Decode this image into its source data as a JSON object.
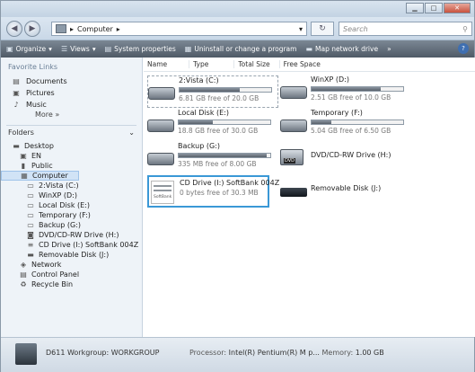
{
  "address": {
    "segments": [
      "Computer"
    ],
    "search_placeholder": "Search"
  },
  "toolbar": {
    "organize": "Organize",
    "views": "Views",
    "system_properties": "System properties",
    "uninstall": "Uninstall or change a program",
    "map_drive": "Map network drive",
    "overflow": "»"
  },
  "sidebar": {
    "favorites_header": "Favorite Links",
    "favorites": [
      "Documents",
      "Pictures",
      "Music"
    ],
    "more": "More »",
    "folders_header": "Folders",
    "tree": [
      "Desktop",
      "EN",
      "Public",
      "Computer",
      "2:Vista (C:)",
      "WinXP (D:)",
      "Local Disk (E:)",
      "Temporary (F:)",
      "Backup (G:)",
      "DVD/CD-RW Drive (H:)",
      "CD Drive (I:) SoftBank 004Z",
      "Removable Disk (J:)",
      "Network",
      "Control Panel",
      "Recycle Bin"
    ]
  },
  "columns": [
    "Name",
    "Type",
    "Total Size",
    "Free Space"
  ],
  "drives": [
    {
      "name": "2:Vista (C:)",
      "free": "6.81 GB free of 20.0 GB",
      "used_fraction": 0.66
    },
    {
      "name": "WinXP (D:)",
      "free": "2.51 GB free of 10.0 GB",
      "used_fraction": 0.75
    },
    {
      "name": "Local Disk (E:)",
      "free": "18.8 GB free of 30.0 GB",
      "used_fraction": 0.37
    },
    {
      "name": "Temporary (F:)",
      "free": "5.04 GB free of 6.50 GB",
      "used_fraction": 0.22
    },
    {
      "name": "Backup (G:)",
      "free": "335 MB free of 8.00 GB",
      "used_fraction": 0.96
    },
    {
      "name": "DVD/CD-RW Drive (H:)"
    },
    {
      "name": "CD Drive (I:) SoftBank 004Z",
      "free": "0 bytes free of 30.3 MB"
    },
    {
      "name": "Removable Disk (J:)"
    }
  ],
  "softbank_label": "SoftBank",
  "status": {
    "computer": "D611  Workgroup: WORKGROUP",
    "processor_label": "Processor:",
    "processor": "Intel(R) Pentium(R) M p...",
    "memory_label": "Memory:",
    "memory": "1.00 GB"
  }
}
